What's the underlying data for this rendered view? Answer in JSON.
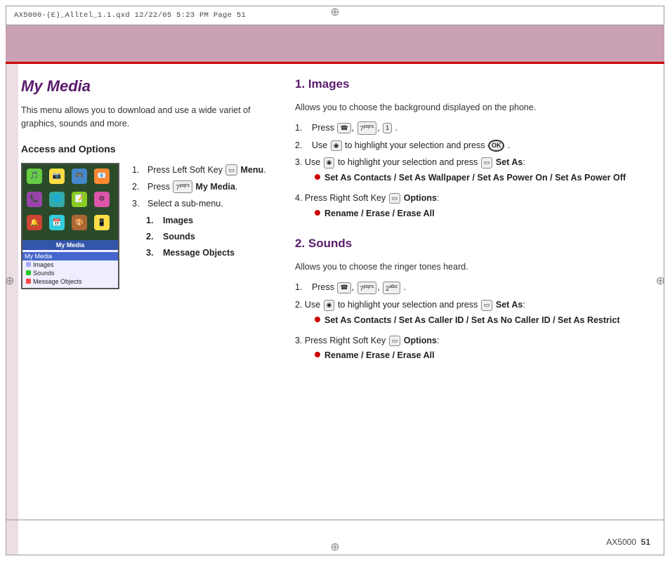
{
  "page": {
    "title": "My Media",
    "header_text": "AX5000-(E)_Alltel_1.1.qxd   12/22/05   5:23 PM   Page 51",
    "description": "This menu allows you to download and use a wide variet of graphics, sounds and more.",
    "page_number": "AX5000  51",
    "accent_color": "#c9a0b4",
    "title_color": "#5a1a6b"
  },
  "left_column": {
    "title": "My Media",
    "description": "This menu allows you to download and use a wide variet of graphics, sounds and more.",
    "access_options_title": "Access and Options",
    "steps": [
      {
        "num": "1.",
        "text": "Press Left Soft Key",
        "icon": "menu-icon",
        "bold": "Menu",
        "punctuation": "."
      },
      {
        "num": "2.",
        "text": "Press",
        "icon": "7pqrs-icon",
        "bold": "My Media",
        "punctuation": "."
      },
      {
        "num": "3.",
        "text": "Select a sub-menu.",
        "icon": null,
        "bold": null,
        "punctuation": ""
      }
    ],
    "sub_menu_items": [
      {
        "num": "1.",
        "label": "Images"
      },
      {
        "num": "2.",
        "label": "Sounds"
      },
      {
        "num": "3.",
        "label": "Message Objects"
      }
    ],
    "phone_label": "My Media",
    "phone_menu": [
      {
        "label": "My Media",
        "highlighted": true,
        "dot_class": ""
      },
      {
        "label": "Images",
        "highlighted": false,
        "dot_class": "img"
      },
      {
        "label": "Sounds",
        "highlighted": false,
        "dot_class": "snd"
      },
      {
        "label": "Message Objects",
        "highlighted": false,
        "dot_class": "msg"
      }
    ]
  },
  "right_column": {
    "sections": [
      {
        "id": "images",
        "title": "1. Images",
        "description": "Allows you to choose the background displayed on the phone.",
        "steps": [
          {
            "num": "1.",
            "text_parts": [
              "Press",
              "ICON_PHONE",
              ",",
              "ICON_7",
              ",",
              "ICON_1",
              "."
            ]
          },
          {
            "num": "2.",
            "text_parts": [
              "Use",
              "ICON_NAV",
              "to highlight your selection and press",
              "ICON_OK",
              "."
            ],
            "bullets": []
          },
          {
            "num": "3.",
            "text_parts": [
              "Use",
              "ICON_NAV",
              "to highlight your selection and press",
              "ICON_SET",
              "Set As:"
            ],
            "bullets": [
              "Set As Contacts / Set As Wallpaper / Set As Power On / Set As Power Off"
            ]
          },
          {
            "num": "4.",
            "text_parts": [
              "Press Right  Soft Key",
              "ICON_OPTIONS",
              "Options:"
            ],
            "bullets": [
              "Rename / Erase / Erase All"
            ]
          }
        ]
      },
      {
        "id": "sounds",
        "title": "2. Sounds",
        "description": "Allows you to choose the ringer tones heard.",
        "steps": [
          {
            "num": "1.",
            "text_parts": [
              "Press",
              "ICON_PHONE",
              ",",
              "ICON_7",
              ",",
              "ICON_2",
              "."
            ]
          },
          {
            "num": "2.",
            "text_parts": [
              "Use",
              "ICON_NAV",
              "to highlight your selection and press",
              "ICON_SET",
              "Set As:"
            ],
            "bullets": [
              "Set As Contacts / Set As Caller ID / Set As No Caller ID / Set As Restrict"
            ]
          },
          {
            "num": "3.",
            "text_parts": [
              "Press Right  Soft Key",
              "ICON_OPTIONS",
              "Options:"
            ],
            "bullets": [
              "Rename / Erase / Erase All"
            ]
          }
        ]
      }
    ]
  },
  "footer": {
    "page_label": "AX5000",
    "page_number": "51"
  }
}
